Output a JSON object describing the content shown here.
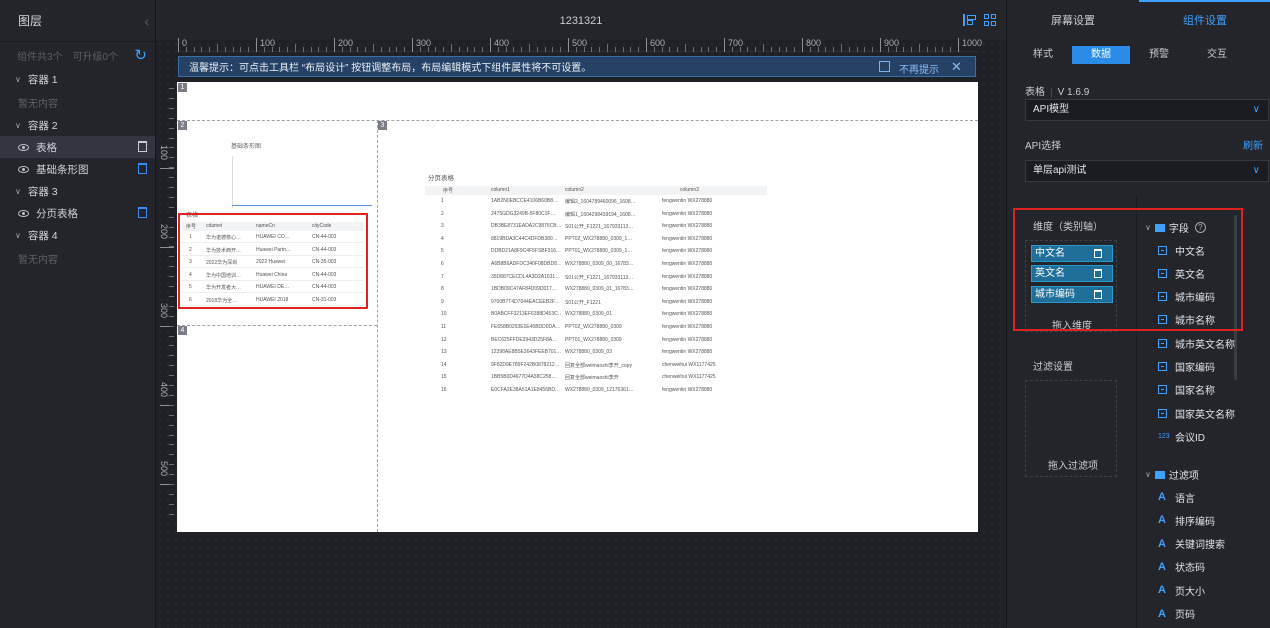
{
  "left_panel": {
    "title": "图层",
    "component_count": "组件共3个",
    "upgradable": "可升级0个",
    "empty_text": "暂无内容",
    "containers": [
      {
        "label": "容器 1",
        "items": []
      },
      {
        "label": "容器 2",
        "items": [
          "表格",
          "基础条形图"
        ]
      },
      {
        "label": "容器 3",
        "items": [
          "分页表格"
        ]
      },
      {
        "label": "容器 4",
        "items": []
      }
    ]
  },
  "toolbar": {
    "title": "1231321"
  },
  "ruler": {
    "h_labels": [
      "0",
      "100",
      "200",
      "300",
      "400",
      "500",
      "600",
      "700",
      "800",
      "900",
      "1000"
    ],
    "v_labels": [
      "100",
      "200",
      "300",
      "400",
      "500"
    ]
  },
  "tip": {
    "text": "温馨提示：可点击工具栏 “布局设计” 按钮调整布局，布局编辑模式下组件属性将不可设置。",
    "no_show": "不再提示"
  },
  "canvas": {
    "block_numbers": [
      "1",
      "2",
      "3",
      "4"
    ],
    "bar_chart_title": "基础条形图",
    "small_table": {
      "title": "表格",
      "columns": [
        "序号",
        "cdamet",
        "nameCn",
        "cityCode"
      ],
      "rows": [
        [
          "1",
          "华为诺德核心…",
          "HUAWEI CO…",
          "CN-44-003"
        ],
        [
          "2",
          "华为技术西开…",
          "Huawei Partn…",
          "CN-44-003"
        ],
        [
          "3",
          "2022华为深圳",
          "2022 Huawei",
          "CN-35-003"
        ],
        [
          "4",
          "华为中国培训…",
          "Huawei China",
          "CN-44-003"
        ],
        [
          "5",
          "华为开发者大…",
          "HUAWEI DE…",
          "CN-44-003"
        ],
        [
          "6",
          "2018华为全…",
          "HUAWEI 2018",
          "CN-31-003"
        ]
      ]
    },
    "paged_table": {
      "title": "分页表格",
      "columns": [
        "序号",
        "column1",
        "column2",
        "column3"
      ],
      "rows": [
        [
          "1",
          "1AB2N0EBCCE4106B60B8…",
          "编辑2_1604789460096_1608…",
          "fengwentin WX278880"
        ],
        [
          "2",
          "2475GDG3249B-5F80C1F…",
          "编辑1_1604298439194_1608…",
          "fengwentin WX278880"
        ],
        [
          "3",
          "DB3BE8731EADA2C9876CB…",
          "S01公开_F1221_1679331​13…",
          "fengwentin WX278880"
        ],
        [
          "4",
          "8819BDA3C44C4DFDB380…",
          "PPT02_WX278880_0309_1…",
          "fengwentin WX278880"
        ],
        [
          "5",
          "DDBD21A8F9C4F5FSBF316…",
          "PPT01_WX278880_0309_1…",
          "fengwentin WX278880"
        ],
        [
          "6",
          "A6B8B6ADFDC340F08DBD8…",
          "WX278880_0309_00_16783…",
          "fengwentin WX278880"
        ],
        [
          "7",
          "35D887CECDL4A3D2A1631…",
          "S01公开_F1221_1679331​13…",
          "fengwentin WX278880"
        ],
        [
          "8",
          "1BDB09C47AF84D09D017…",
          "WX278880_0309_01_16783…",
          "fengwentin WX278880"
        ],
        [
          "9",
          "9700B7T4D7044EACEEB2F…",
          "S01公开_F1221",
          "fengwentin WX278880"
        ],
        [
          "10",
          "B0ABCFF3213EF6388D453C…",
          "WX278880_0309_01",
          "fengwentin WX278880"
        ],
        [
          "11",
          "FE658B0293E1E45BDD0DA…",
          "PPT02_WX278880_0309",
          "fengwentin WX278880"
        ],
        [
          "12",
          "BEC625FFDE3943D25F8A…",
          "PPT01_WX278880_0309",
          "fengwentin WX278880"
        ],
        [
          "13",
          "12398AE8B5E3643FEEB701…",
          "WX278880_0309_03",
          "fengwentin WX278880"
        ],
        [
          "14",
          "9F82D9E789F242B0878212…",
          "回复全部weimaoshi李开_copy",
          "chenweihui WX1177425"
        ],
        [
          "15",
          "1BB5B0D4677D4A38C258…",
          "回复全部weimaoshi李开",
          "chenweihui WX1177425"
        ],
        [
          "16",
          "E0CFA2E38A51A1E8456BD…",
          "WX278880_0309_12176361…",
          "fengwentin WX278880"
        ]
      ]
    }
  },
  "right_panel": {
    "tabs": [
      "屏幕设置",
      "组件设置"
    ],
    "subtabs": [
      "样式",
      "数据",
      "预警",
      "交互"
    ],
    "table_label": "表格",
    "version": "V 1.6.9",
    "api_model": "API模型",
    "api_select_label": "API选择",
    "refresh": "刷新",
    "api_value": "单层api测试",
    "dimension_label": "维度（类别轴）",
    "dimension_chips": [
      "中文名",
      "英文名",
      "城市编码"
    ],
    "drop_dimension": "拖入维度",
    "filter_label": "过滤设置",
    "drop_filter": "拖入过滤项",
    "fields_group": "字段",
    "help_icon": "?",
    "fields": [
      "中文名",
      "英文名",
      "城市编码",
      "城市名称",
      "城市英文名称",
      "国家编码",
      "国家名称",
      "国家英文名称"
    ],
    "id_field": "会议ID",
    "id_icon_text": "123",
    "filters_group": "过滤项",
    "filters": [
      "语言",
      "排序编码",
      "关键词搜索",
      "状态码",
      "页大小",
      "页码"
    ],
    "accent": "#3ea0ff"
  }
}
